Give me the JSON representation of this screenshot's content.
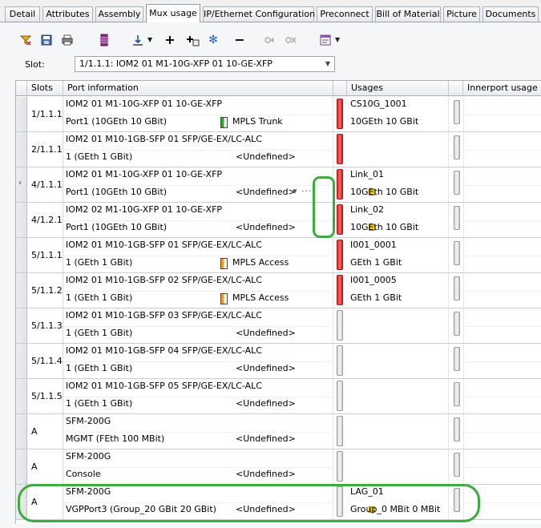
{
  "tabs": [
    "Detail",
    "Attributes",
    "Assembly",
    "Mux usage",
    "IP/Ethernet Configuration",
    "Preconnect",
    "Bill of Material",
    "Picture",
    "Documents"
  ],
  "active_tab": "Mux usage",
  "toolbar": {
    "icons": [
      "filter-icon",
      "save-icon",
      "print-icon",
      "columns-icon",
      "sort-icon",
      "add-icon",
      "add-child-icon",
      "snowflake-icon",
      "remove-icon",
      "connect-icon",
      "disconnect-icon",
      "form-icon"
    ]
  },
  "slot": {
    "label": "Slot:",
    "value": "1/1.1.1: IOM2 01 M1-10G-XFP 01 10-GE-XFP"
  },
  "grid": {
    "headers": {
      "slots": "Slots",
      "port_info": "Port information",
      "usages": "Usages",
      "innerport": "Innerport usage"
    },
    "rows": [
      {
        "slot": "1/1.1.1",
        "module": "IOM2 01 M1-10G-XFP 01 10-GE-XFP",
        "port": "Port1 (10GEth 10 GBit)",
        "badge": "MPLS Trunk",
        "badge_color": "#3aa335",
        "bar": "red",
        "usage1": "CS10G_1001",
        "usage2": "10GEth 10 GBit"
      },
      {
        "slot": "2/1.1.1",
        "module": "IOM2 01 M10-1GB-SFP 01 SFP/GE-EX/LC-ALC",
        "port": "1 (GEth 1 GBit)",
        "value": "<Undefined>",
        "bar": "red"
      },
      {
        "slot": "4/1.1.1",
        "module": "IOM2 01 M1-10G-XFP 01 10-GE-XFP",
        "port": "Port1 (10GEth 10 GBit)",
        "value": "<Undefined>",
        "extra": "▾ ···",
        "flag": true,
        "bar": "red",
        "usage1": "Link_01",
        "usage2": "10GEth 10 GBit",
        "current": true
      },
      {
        "slot": "4/1.2.1",
        "module": "IOM2 02 M1-10G-XFP 01 10-GE-XFP",
        "port": "Port1 (10GEth 10 GBit)",
        "value": "<Undefined>",
        "flag": true,
        "bar": "red",
        "usage1": "Link_02",
        "usage2": "10GEth 10 GBit"
      },
      {
        "slot": "5/1.1.1",
        "module": "IOM2 01 M10-1GB-SFP 01 SFP/GE-EX/LC-ALC",
        "port": "1 (GEth 1 GBit)",
        "badge": "MPLS Access",
        "badge_color": "#f0a020",
        "bar": "red",
        "usage1": "I001_0001",
        "usage2": "GEth 1 GBit"
      },
      {
        "slot": "5/1.1.2",
        "module": "IOM2 01 M10-1GB-SFP 02 SFP/GE-EX/LC-ALC",
        "port": "1 (GEth 1 GBit)",
        "badge": "MPLS Access",
        "badge_color": "#f0a020",
        "bar": "red",
        "usage1": "I001_0005",
        "usage2": "GEth 1 GBit"
      },
      {
        "slot": "5/1.1.3",
        "module": "IOM2 01 M10-1GB-SFP 03 SFP/GE-EX/LC-ALC",
        "port": "1 (GEth 1 GBit)",
        "value": "<Undefined>",
        "bar": "gray"
      },
      {
        "slot": "5/1.1.4",
        "module": "IOM2 01 M10-1GB-SFP 04 SFP/GE-EX/LC-ALC",
        "port": "1 (GEth 1 GBit)",
        "value": "<Undefined>",
        "bar": "gray"
      },
      {
        "slot": "5/1.1.5",
        "module": "IOM2 01 M10-1GB-SFP 05 SFP/GE-EX/LC-ALC",
        "port": "1 (GEth 1 GBit)",
        "value": "<Undefined>",
        "bar": "gray"
      },
      {
        "slot": "A",
        "module": "SFM-200G",
        "port": "MGMT (FEth 100 MBit)",
        "value": "<Undefined>",
        "bar": "gray"
      },
      {
        "slot": "A",
        "module": "SFM-200G",
        "port": "Console",
        "value": "<Undefined>",
        "bar": "gray"
      },
      {
        "slot": "A",
        "module": "SFM-200G",
        "port": "VGPPort3 (Group_20 GBit 20 GBit)",
        "value": "<Undefined>",
        "flag": true,
        "bar": "gray",
        "usage1": "LAG_01",
        "usage2": "Group_0 MBit 0 MBit"
      }
    ]
  },
  "colors": {
    "highlight": "#3cac3c",
    "flag": "#f3d227",
    "bar_red": "#e03434"
  }
}
